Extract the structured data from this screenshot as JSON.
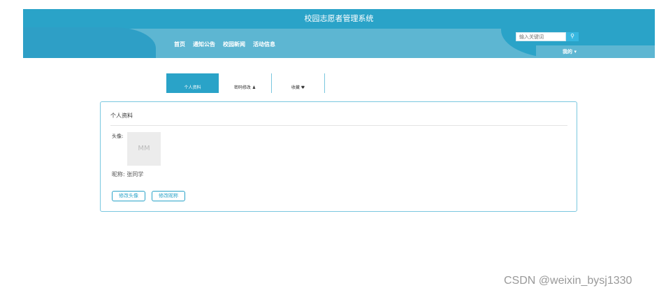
{
  "app": {
    "title": "校园志愿者管理系统"
  },
  "nav": {
    "items": [
      "首页",
      "通知公告",
      "校园新闻",
      "活动信息"
    ]
  },
  "search": {
    "placeholder": "输入关键词",
    "button_icon": "search-icon"
  },
  "user_menu": {
    "label": "我的",
    "icon": "caret-down-icon"
  },
  "tabs": [
    {
      "label": "个人资料",
      "active": true
    },
    {
      "label": "密码修改",
      "icon": "user-icon",
      "active": false
    },
    {
      "label": "收藏",
      "icon": "heart-icon",
      "active": false
    }
  ],
  "profile": {
    "section_title": "个人资料",
    "avatar_label": "头像:",
    "avatar_placeholder": "MM",
    "nickname_label": "昵称:",
    "nickname_value": "张同学",
    "change_avatar_button": "修改头像",
    "change_nickname_button": "修改昵称"
  },
  "watermark": "CSDN @weixin_bysj1330",
  "colors": {
    "header_dark": "#2aa3c8",
    "header_light": "#5db6d2",
    "accent": "#37b7e0"
  }
}
